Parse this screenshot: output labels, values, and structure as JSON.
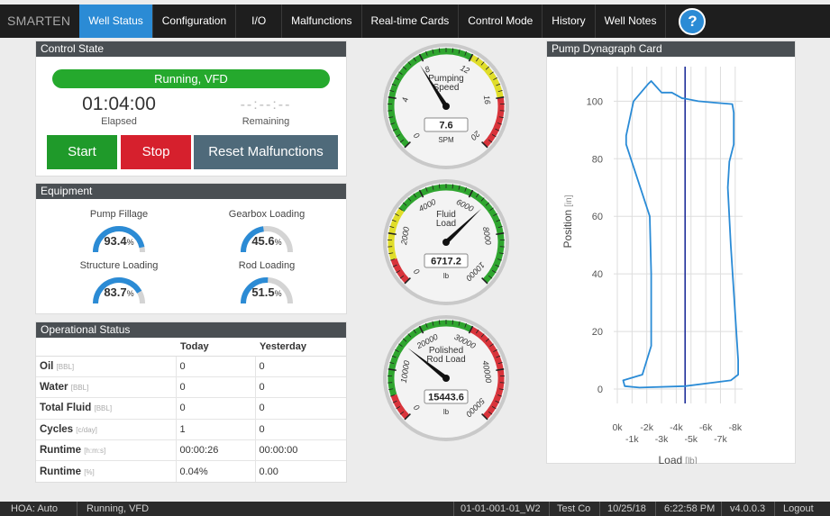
{
  "nav": {
    "brand": "SMARTEN",
    "items": [
      "Well Status",
      "Configuration",
      "I/O",
      "Malfunctions",
      "Real-time Cards",
      "Control Mode",
      "History",
      "Well Notes"
    ],
    "help": "?"
  },
  "control_state": {
    "title": "Control State",
    "status": "Running, VFD",
    "elapsed_value": "01:04:00",
    "elapsed_label": "Elapsed",
    "remaining_value": "--:--:--",
    "remaining_label": "Remaining",
    "buttons": {
      "start": "Start",
      "stop": "Stop",
      "reset": "Reset Malfunctions"
    }
  },
  "equipment": {
    "title": "Equipment",
    "items": [
      {
        "label": "Pump Fillage",
        "value": "93.4",
        "unit": "%",
        "fraction": 0.934
      },
      {
        "label": "Gearbox Loading",
        "value": "45.6",
        "unit": "%",
        "fraction": 0.456
      },
      {
        "label": "Structure Loading",
        "value": "83.7",
        "unit": "%",
        "fraction": 0.837
      },
      {
        "label": "Rod Loading",
        "value": "51.5",
        "unit": "%",
        "fraction": 0.515
      }
    ]
  },
  "operational": {
    "title": "Operational Status",
    "headers": [
      "",
      "Today",
      "Yesterday"
    ],
    "rows": [
      {
        "name": "Oil",
        "unit": "[BBL]",
        "today": "0",
        "yesterday": "0"
      },
      {
        "name": "Water",
        "unit": "[BBL]",
        "today": "0",
        "yesterday": "0"
      },
      {
        "name": "Total Fluid",
        "unit": "[BBL]",
        "today": "0",
        "yesterday": "0"
      },
      {
        "name": "Cycles",
        "unit": "[c/day]",
        "today": "1",
        "yesterday": "0"
      },
      {
        "name": "Runtime",
        "unit": "[h:m:s]",
        "today": "00:00:26",
        "yesterday": "00:00:00"
      },
      {
        "name": "Runtime",
        "unit": "[%]",
        "today": "0.04%",
        "yesterday": "0.00"
      }
    ]
  },
  "gauges": [
    {
      "title": [
        "Pumping",
        "Speed"
      ],
      "value": "7.6",
      "unit": "SPM",
      "min": 0,
      "max": 20,
      "needle": 7.6,
      "ticks": [
        "0",
        "4",
        "8",
        "12",
        "16",
        "20"
      ],
      "bands": [
        {
          "from": 0,
          "to": 12,
          "color": "#2fa52f"
        },
        {
          "from": 12,
          "to": 16,
          "color": "#e0dd2a"
        },
        {
          "from": 16,
          "to": 20,
          "color": "#d8343b"
        }
      ]
    },
    {
      "title": [
        "Fluid",
        "Load"
      ],
      "value": "6717.2",
      "unit": "lb",
      "min": 0,
      "max": 10000,
      "needle": 6717.2,
      "ticks": [
        "0",
        "2000",
        "4000",
        "6000",
        "8000",
        "10000"
      ],
      "bands": [
        {
          "from": 0,
          "to": 1000,
          "color": "#d8343b"
        },
        {
          "from": 1000,
          "to": 3000,
          "color": "#e0dd2a"
        },
        {
          "from": 3000,
          "to": 10000,
          "color": "#2fa52f"
        }
      ]
    },
    {
      "title": [
        "Polished",
        "Rod Load"
      ],
      "value": "15443.6",
      "unit": "lb",
      "min": 0,
      "max": 50000,
      "needle": 15443.6,
      "ticks": [
        "0",
        "10000",
        "20000",
        "30000",
        "40000",
        "50000"
      ],
      "bands": [
        {
          "from": 0,
          "to": 5000,
          "color": "#d8343b"
        },
        {
          "from": 5000,
          "to": 30000,
          "color": "#2fa52f"
        },
        {
          "from": 30000,
          "to": 45000,
          "color": "#d8343b"
        },
        {
          "from": 45000,
          "to": 50000,
          "color": "#d8343b"
        }
      ]
    }
  ],
  "chart_data": {
    "type": "line",
    "title": "Pump Dynagraph Card",
    "xlabel": "Load",
    "xunit": "[lb]",
    "ylabel": "Position",
    "yunit": "[in]",
    "xlim": [
      0,
      -8500
    ],
    "ylim": [
      -5,
      112
    ],
    "x_ticks_upper": [
      "0k",
      "-2k",
      "-4k",
      "-6k",
      "-8k"
    ],
    "x_ticks_lower": [
      "-1k",
      "-3k",
      "-5k",
      "-7k"
    ],
    "y_ticks": [
      "0",
      "20",
      "40",
      "60",
      "80",
      "100"
    ],
    "grid": true,
    "vline_x": -4600,
    "series": [
      {
        "color": "#2a8bd6",
        "points": [
          [
            -4500,
            101
          ],
          [
            -5500,
            100
          ],
          [
            -6600,
            99.5
          ],
          [
            -7800,
            99
          ],
          [
            -7900,
            96
          ],
          [
            -7900,
            85
          ],
          [
            -7600,
            79
          ],
          [
            -7500,
            70
          ],
          [
            -7700,
            50
          ],
          [
            -8200,
            10
          ],
          [
            -8200,
            5
          ],
          [
            -7700,
            3
          ],
          [
            -4600,
            1
          ],
          [
            -1500,
            0.5
          ],
          [
            -500,
            1
          ],
          [
            -400,
            3
          ],
          [
            -1700,
            5
          ],
          [
            -2300,
            15
          ],
          [
            -2300,
            40
          ],
          [
            -2200,
            60
          ],
          [
            -600,
            85
          ],
          [
            -600,
            88
          ],
          [
            -1100,
            100
          ],
          [
            -2100,
            106
          ],
          [
            -2300,
            107
          ],
          [
            -3000,
            103
          ],
          [
            -3700,
            103
          ],
          [
            -4400,
            101
          ],
          [
            -4500,
            101
          ]
        ]
      }
    ]
  },
  "footer": {
    "hoa": "HOA: Auto",
    "status": "Running, VFD",
    "well_id": "01-01-001-01_W2",
    "company": "Test Co",
    "date": "10/25/18",
    "time": "6:22:58 PM",
    "version": "v4.0.0.3",
    "logout": "Logout"
  }
}
